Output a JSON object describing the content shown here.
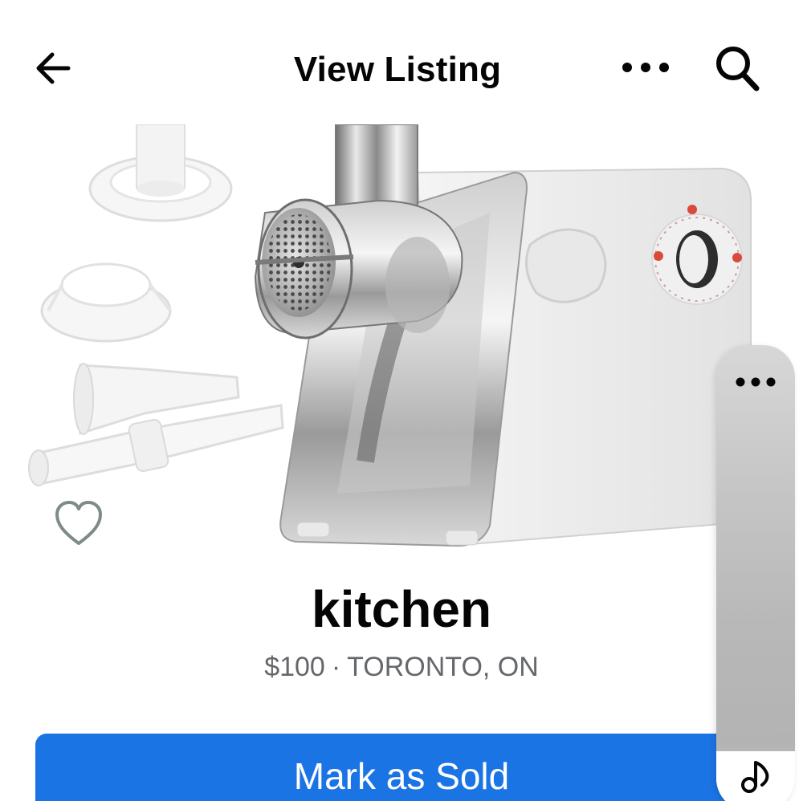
{
  "header": {
    "title": "View Listing",
    "back_icon": "arrow-left-icon",
    "more_icon": "more-horizontal-icon",
    "search_icon": "search-icon"
  },
  "listing": {
    "image_subject": "stainless steel electric meat grinder with white attachments",
    "save_icon": "heart-outline-icon",
    "title": "kitchen",
    "price": "$100",
    "separator": "·",
    "location": "TORONTO, ON"
  },
  "actions": {
    "mark_sold_label": "Mark as Sold",
    "primary_color": "#1b74e4"
  },
  "side_panel": {
    "more_icon": "more-horizontal-icon",
    "music_icon": "music-note-icon"
  }
}
